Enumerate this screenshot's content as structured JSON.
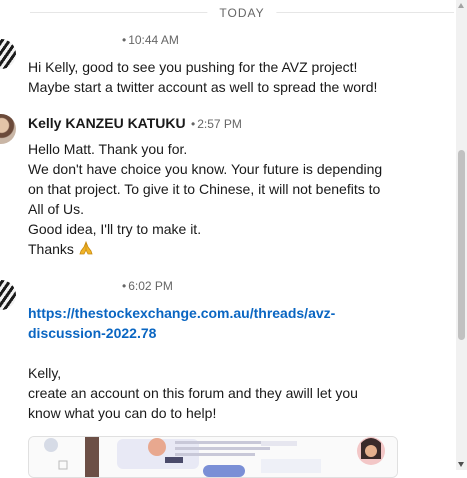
{
  "divider": {
    "label": "TODAY"
  },
  "messages": [
    {
      "avatar": "zebra-avatar",
      "time": "10:44 AM",
      "lines": [
        "Hi Kelly, good to see you pushing for the AVZ project!",
        "Maybe start a twitter account as well to spread the word!"
      ]
    },
    {
      "avatar": "person-avatar",
      "sender": "Kelly KANZEU KATUKU",
      "time": "2:57 PM",
      "lines": [
        "Hello Matt. Thank you for.",
        "We don't have choice you know. Your future is depending",
        "on that project. To give it to Chinese, it will not benefits to",
        "All of Us.",
        "Good idea, I'll try to make it.",
        "Thanks"
      ],
      "emoji": "folded-hands-icon"
    },
    {
      "avatar": "zebra-avatar",
      "time": "6:02 PM",
      "link_lines": [
        "https://thestockexchange.com.au/threads/avz-",
        "discussion-2022.78"
      ],
      "lines": [
        "Kelly,",
        "create an account on this forum and they awill let you",
        "know what you can do to help!"
      ]
    }
  ],
  "preview": {
    "type": "link-preview-image"
  },
  "colors": {
    "link": "#0a66c2",
    "meta": "#666666",
    "text": "#1a1a1a",
    "divider_line": "#e6e6e6",
    "emoji": "#f0b429"
  }
}
